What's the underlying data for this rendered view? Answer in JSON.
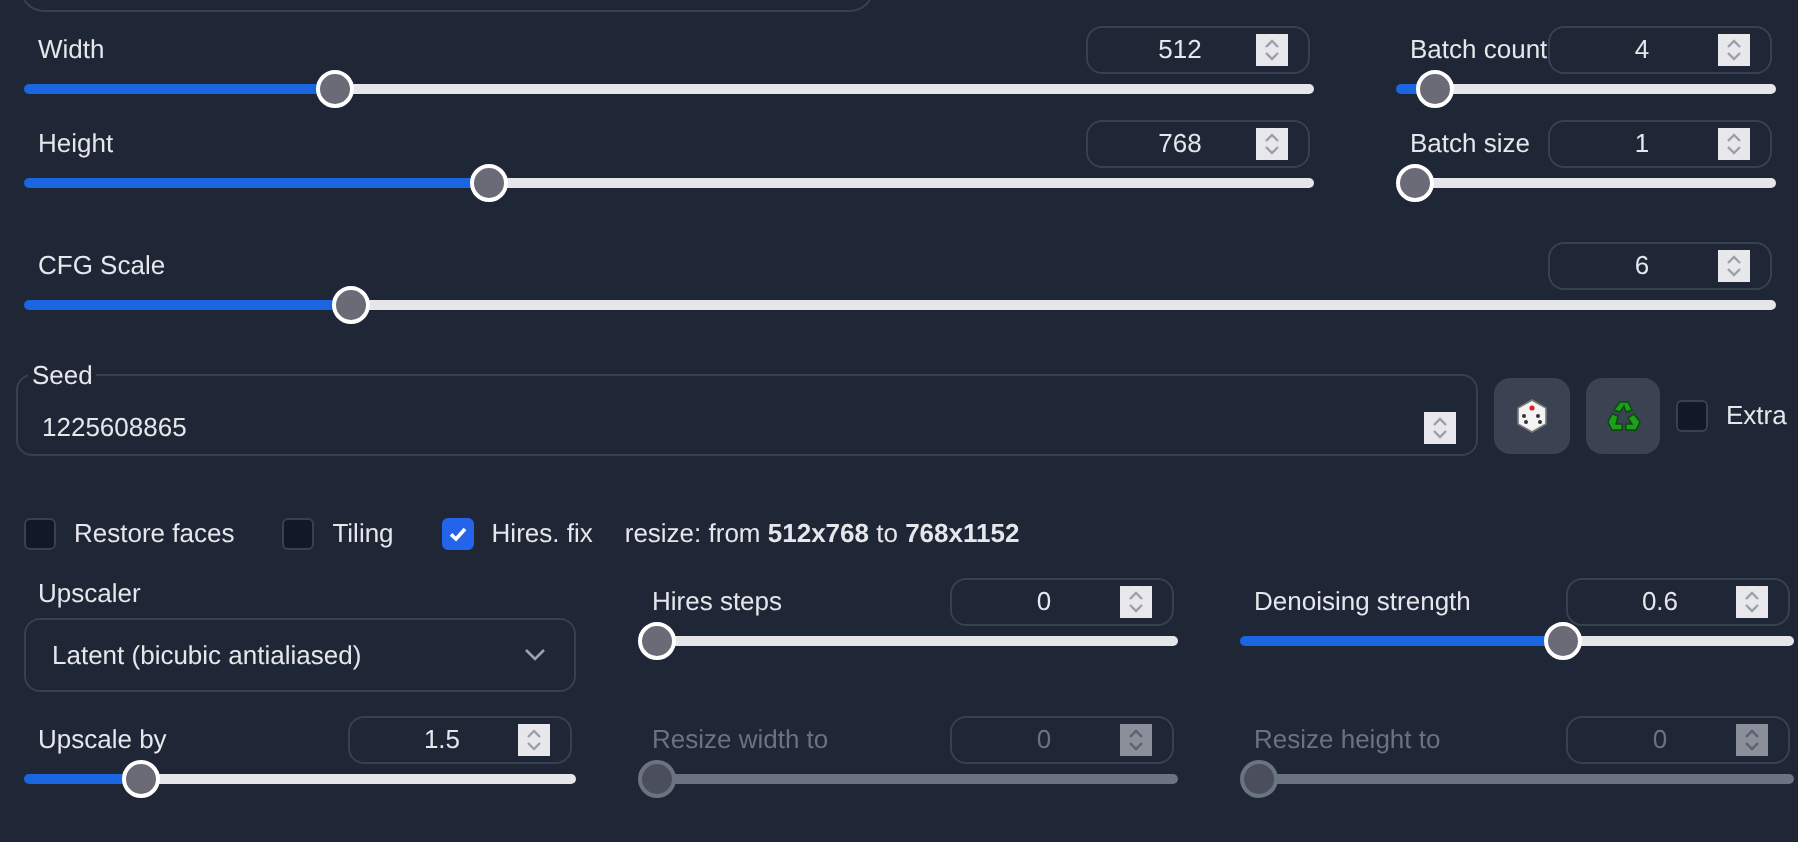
{
  "size_sliders": [
    {
      "label": "Width",
      "value": "512",
      "level": 0.234,
      "disabled": false
    },
    {
      "label": "Height",
      "value": "768",
      "level": 0.357,
      "disabled": false
    }
  ],
  "batch_sliders": [
    {
      "label": "Batch count",
      "value": "4",
      "level": 0.06,
      "disabled": false
    },
    {
      "label": "Batch size",
      "value": "1",
      "level": 0,
      "disabled": false
    }
  ],
  "cfg_slider": {
    "label": "CFG Scale",
    "value": "6",
    "level": 0.18,
    "disabled": false
  },
  "seed": {
    "label": "Seed",
    "value": "1225608865"
  },
  "extra": {
    "label": "Extra",
    "checked": false
  },
  "options": [
    {
      "label": "Restore faces",
      "checked": false
    },
    {
      "label": "Tiling",
      "checked": false
    },
    {
      "label": "Hires. fix",
      "checked": true
    }
  ],
  "resize_note": "resize: from **512x768** to **768x1152**",
  "upscaler": {
    "label": "Upscaler",
    "value": "Latent (bicubic antialiased)"
  },
  "hires_sliders": [
    {
      "label": "Hires steps",
      "value": "0",
      "level": 0,
      "disabled": false
    },
    {
      "label": "Denoising strength",
      "value": "0.6",
      "level": 0.59,
      "disabled": false
    },
    {
      "label": "Upscale by",
      "value": "1.5",
      "level": 0.19,
      "disabled": false
    },
    {
      "label": "Resize width to",
      "value": "0",
      "level": 0,
      "disabled": true
    },
    {
      "label": "Resize height to",
      "value": "0",
      "level": 0,
      "disabled": true
    }
  ]
}
